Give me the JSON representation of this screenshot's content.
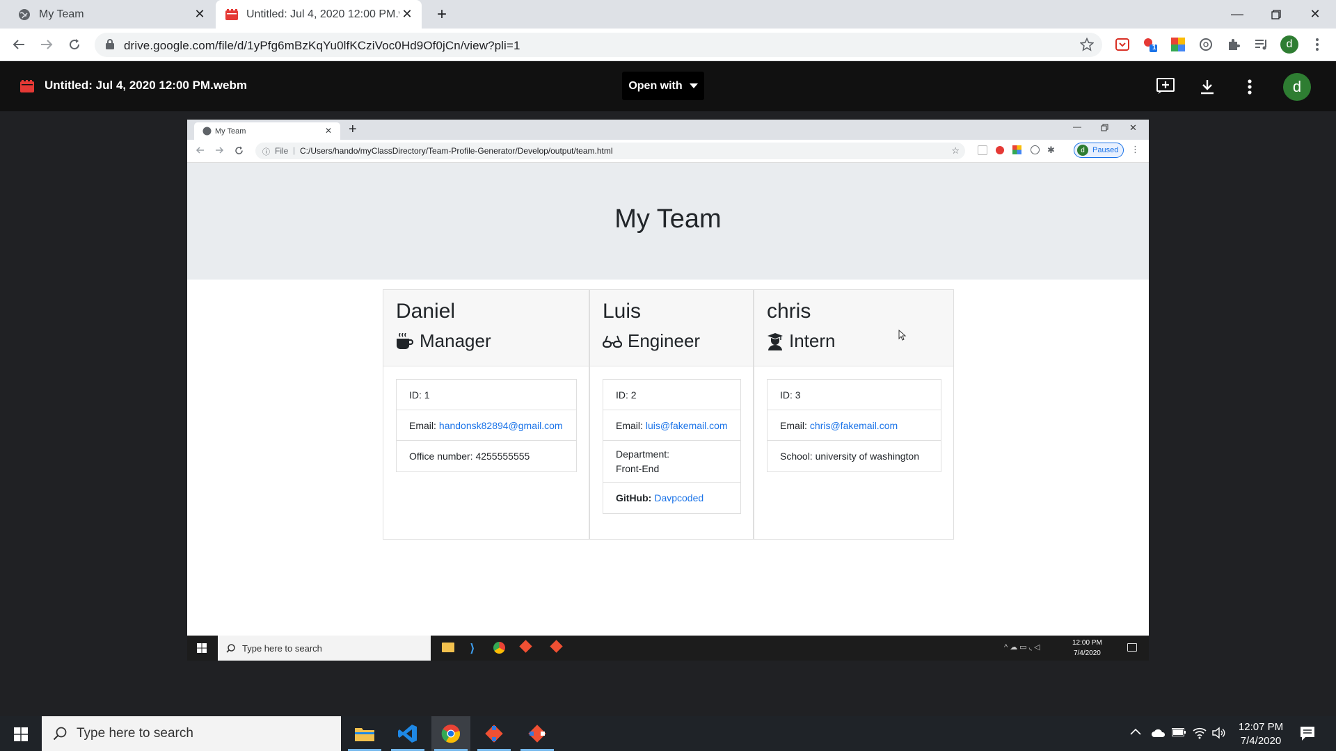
{
  "browser": {
    "tabs": [
      {
        "title": "My Team"
      },
      {
        "title": "Untitled: Jul 4, 2020 12:00 PM.we"
      }
    ],
    "url": "drive.google.com/file/d/1yPfg6mBzKqYu0lfKCziVoc0Hd9Of0jCn/view?pli=1",
    "profile_initial": "d",
    "extension_badge": "1"
  },
  "drive": {
    "file_title": "Untitled: Jul 4, 2020 12:00 PM.webm",
    "open_with_label": "Open with",
    "avatar_initial": "d"
  },
  "video": {
    "tab_title": "My Team",
    "url_prefix": "File",
    "url": "C:/Users/hando/myClassDirectory/Team-Profile-Generator/Develop/output/team.html",
    "paused_label": "Paused",
    "profile_initial": "d",
    "page_title": "My Team",
    "team": [
      {
        "name": "Daniel",
        "role": "Manager",
        "role_icon": "coffee-mug-icon",
        "id": "ID: 1",
        "email_label": "Email:",
        "email": "handonsk82894@gmail.com",
        "extra": "Office number: 4255555555"
      },
      {
        "name": "Luis",
        "role": "Engineer",
        "role_icon": "glasses-icon",
        "id": "ID: 2",
        "email_label": "Email:",
        "email": "luis@fakemail.com",
        "extra_line1": "Department:",
        "extra_line2": "Front-End",
        "github_label": "GitHub:",
        "github": "Davpcoded"
      },
      {
        "name": "chris",
        "role": "Intern",
        "role_icon": "graduate-icon",
        "id": "ID: 3",
        "email_label": "Email:",
        "email": "chris@fakemail.com",
        "extra": "School: university of washington"
      }
    ],
    "taskbar_search": "Type here to search",
    "clock_time": "12:00 PM",
    "clock_date": "7/4/2020"
  },
  "taskbar": {
    "search_placeholder": "Type here to search",
    "time": "12:07 PM",
    "date": "7/4/2020"
  },
  "colors": {
    "link": "#1a73e8",
    "drive_header": "#111111",
    "viewer_bg": "#202124",
    "jumbotron": "#e9ecef",
    "avatar": "#2e7d32"
  }
}
